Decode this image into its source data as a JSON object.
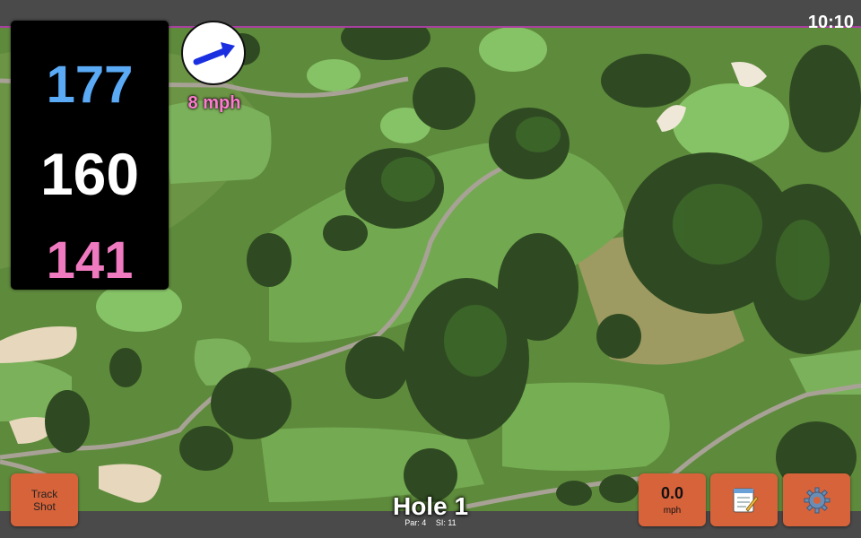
{
  "status": {
    "time": "10:10"
  },
  "distances": {
    "back": "177",
    "center": "160",
    "front": "141"
  },
  "wind": {
    "speed": "8 mph",
    "direction_icon": "arrow-icon"
  },
  "controls": {
    "track_shot_label": "Track\nShot",
    "speed_value": "0.0",
    "speed_unit": "mph",
    "notes_icon": "notepad-icon",
    "settings_icon": "gear-icon"
  },
  "hole": {
    "title": "Hole 1",
    "par": "Par: 4",
    "si": "SI: 11"
  },
  "colors": {
    "back": "#5aaaf6",
    "center": "#ffffff",
    "front": "#f07ac0",
    "wind_text": "#ff7bd0",
    "button": "#d7633a",
    "accent_line": "#a93fa0"
  }
}
